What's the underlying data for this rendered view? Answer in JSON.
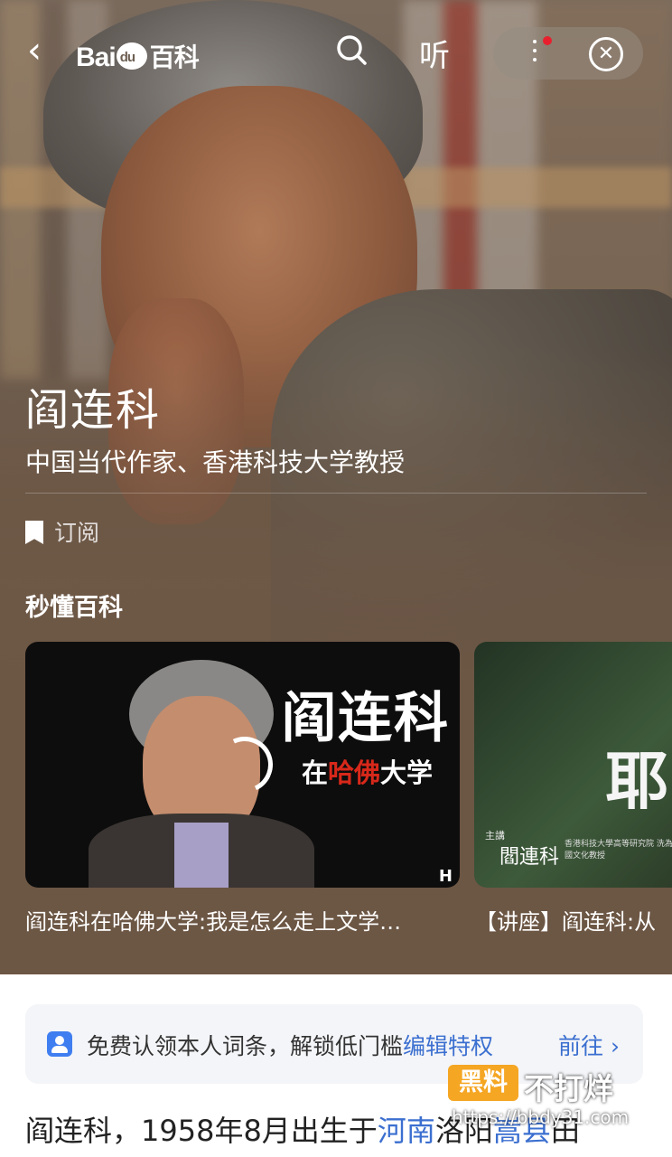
{
  "header": {
    "logo_text": "Bai",
    "logo_du": "du",
    "logo_baike": "百科",
    "listen_label": "听",
    "accent_color": "#e8202e"
  },
  "entry": {
    "name": "阎连科",
    "subtitle": "中国当代作家、香港科技大学教授",
    "subscribe_label": "订阅"
  },
  "quick_section": {
    "title": "秒懂百科",
    "videos": [
      {
        "overlay_title": "阎连科",
        "overlay_sub_1": "在",
        "overlay_sub_2": "哈佛",
        "overlay_sub_3": "大学",
        "title": "阎连科在哈佛大学:我是怎么走上文学…"
      },
      {
        "overlay_big": "耶",
        "overlay_host": "主講",
        "overlay_name": "閻連科",
        "overlay_small": "香港科技大學高等研究院 洗為堅中國文化教授",
        "title": "【讲座】阎连科:从"
      }
    ]
  },
  "claim_banner": {
    "text": "免费认领本人词条，解锁低门槛",
    "highlight": "编辑特权",
    "action": "前往 ›",
    "color": "#3b6fd0"
  },
  "intro": {
    "text_1": "阎连科，1958年8月出生于",
    "link_1": "河南",
    "text_2": "洛阳",
    "link_2": "嵩县",
    "text_3": "田"
  },
  "watermark": {
    "box": "黑料",
    "text": "不打烊",
    "url": "https://bbdy31.com"
  }
}
